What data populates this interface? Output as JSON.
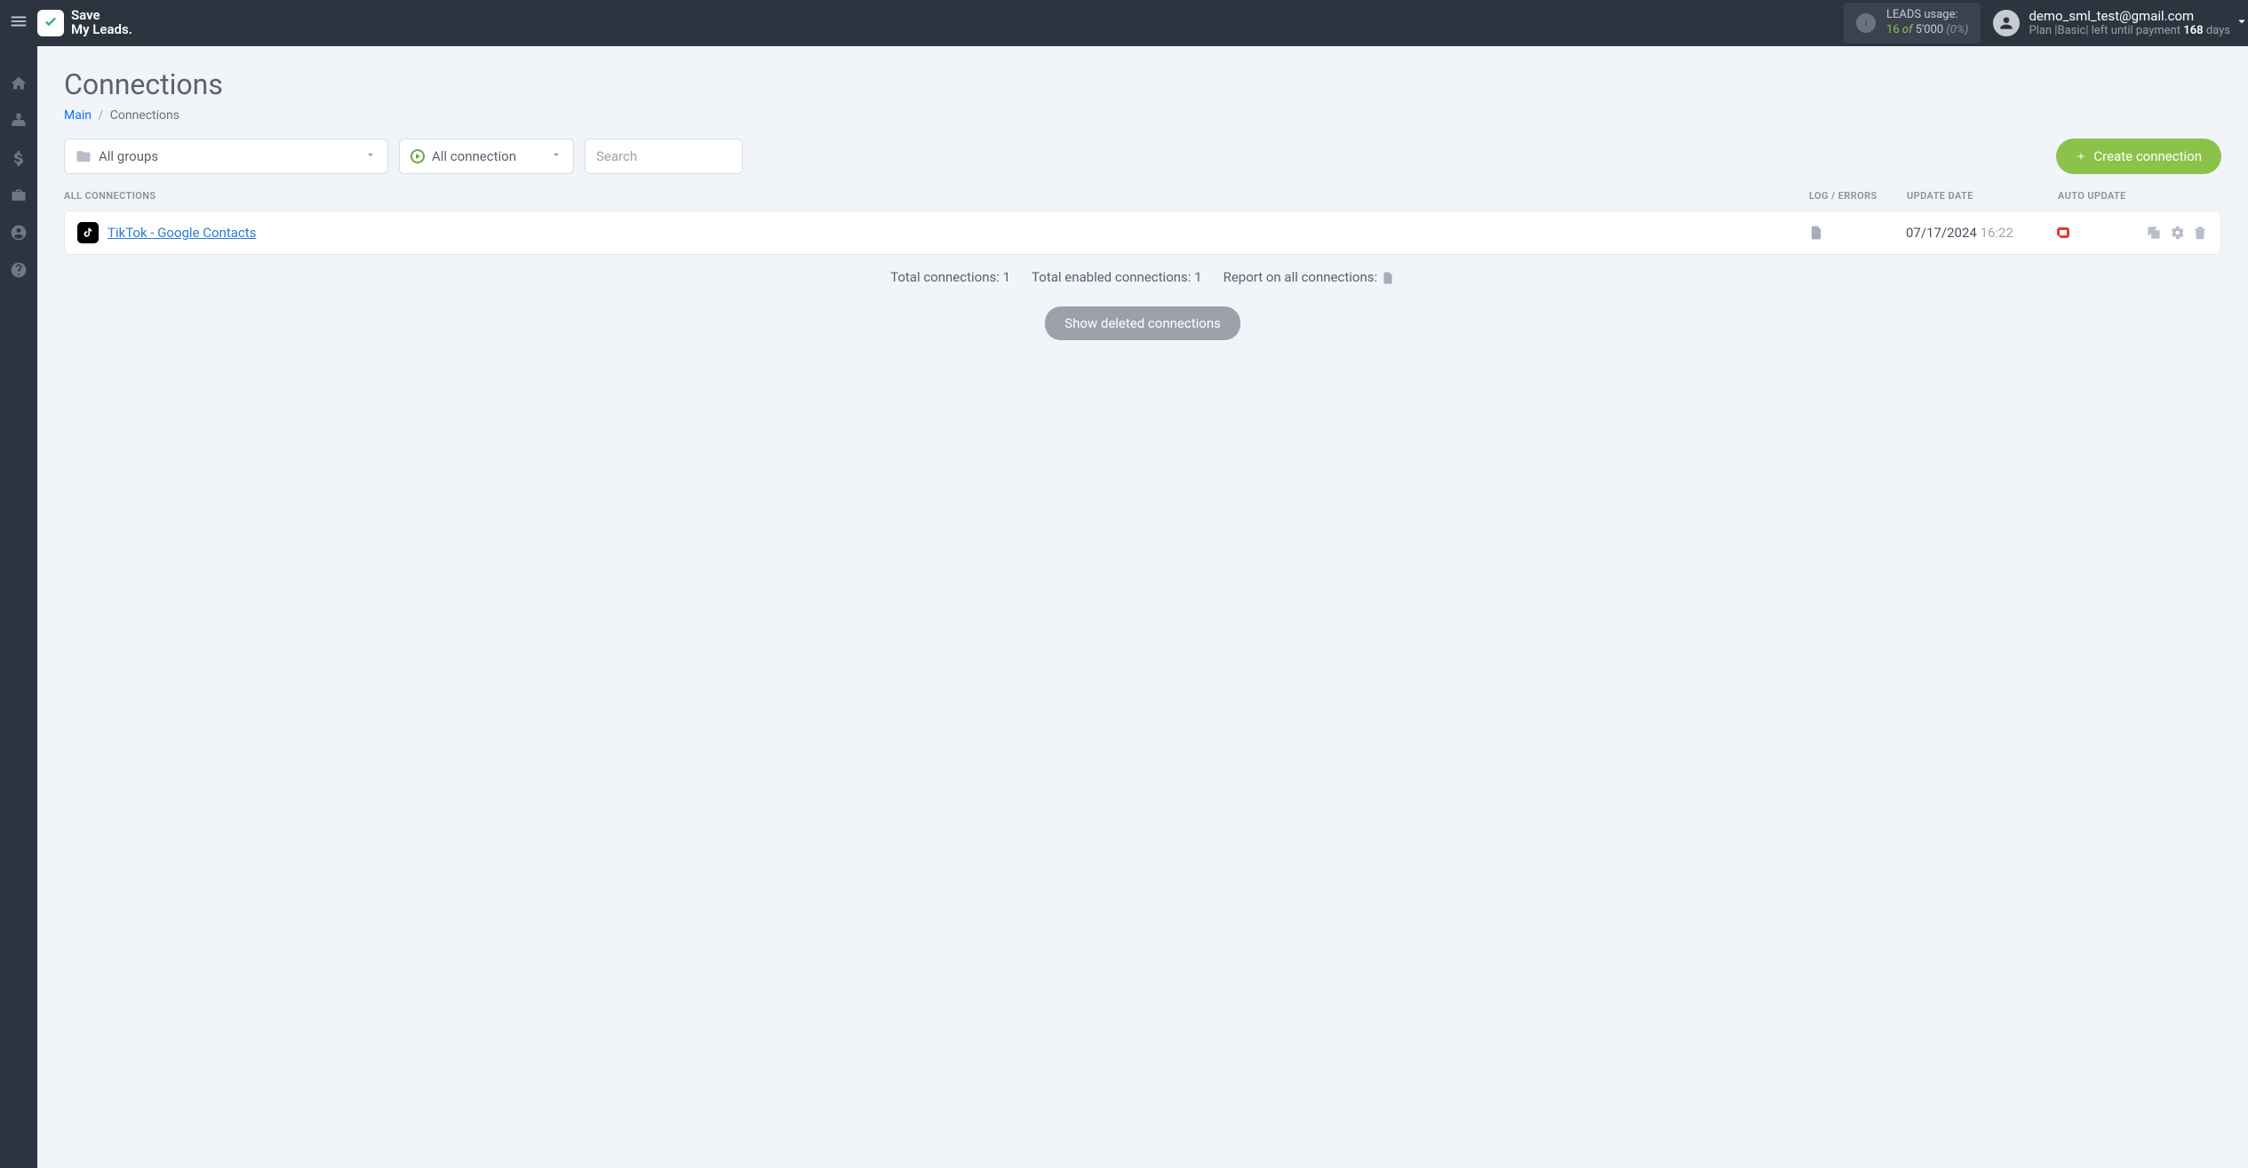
{
  "brand": {
    "line1": "Save",
    "line2": "My Leads."
  },
  "leads_usage": {
    "label": "LEADS usage:",
    "used": "16",
    "of": "of",
    "total": "5'000",
    "pct": "(0%)"
  },
  "user": {
    "email": "demo_sml_test@gmail.com",
    "plan_prefix": "Plan |",
    "plan_name": "Basic",
    "plan_mid": "| left until payment ",
    "days": "168",
    "days_suffix": " days"
  },
  "page": {
    "title": "Connections"
  },
  "breadcrumb": {
    "main": "Main",
    "sep": "/",
    "current": "Connections"
  },
  "filters": {
    "groups_label": "All groups",
    "status_label": "All connection",
    "search_placeholder": "Search"
  },
  "create_button": "Create connection",
  "columns": {
    "name": "ALL CONNECTIONS",
    "log": "LOG / ERRORS",
    "update": "UPDATE DATE",
    "auto": "AUTO UPDATE"
  },
  "rows": [
    {
      "name": "TikTok - Google Contacts",
      "date": "07/17/2024",
      "time": "16:22",
      "auto": true
    }
  ],
  "footer": {
    "total_label": "Total connections:",
    "total_val": "1",
    "enabled_label": "Total enabled connections:",
    "enabled_val": "1",
    "report_label": "Report on all connections:"
  },
  "show_deleted": "Show deleted connections"
}
